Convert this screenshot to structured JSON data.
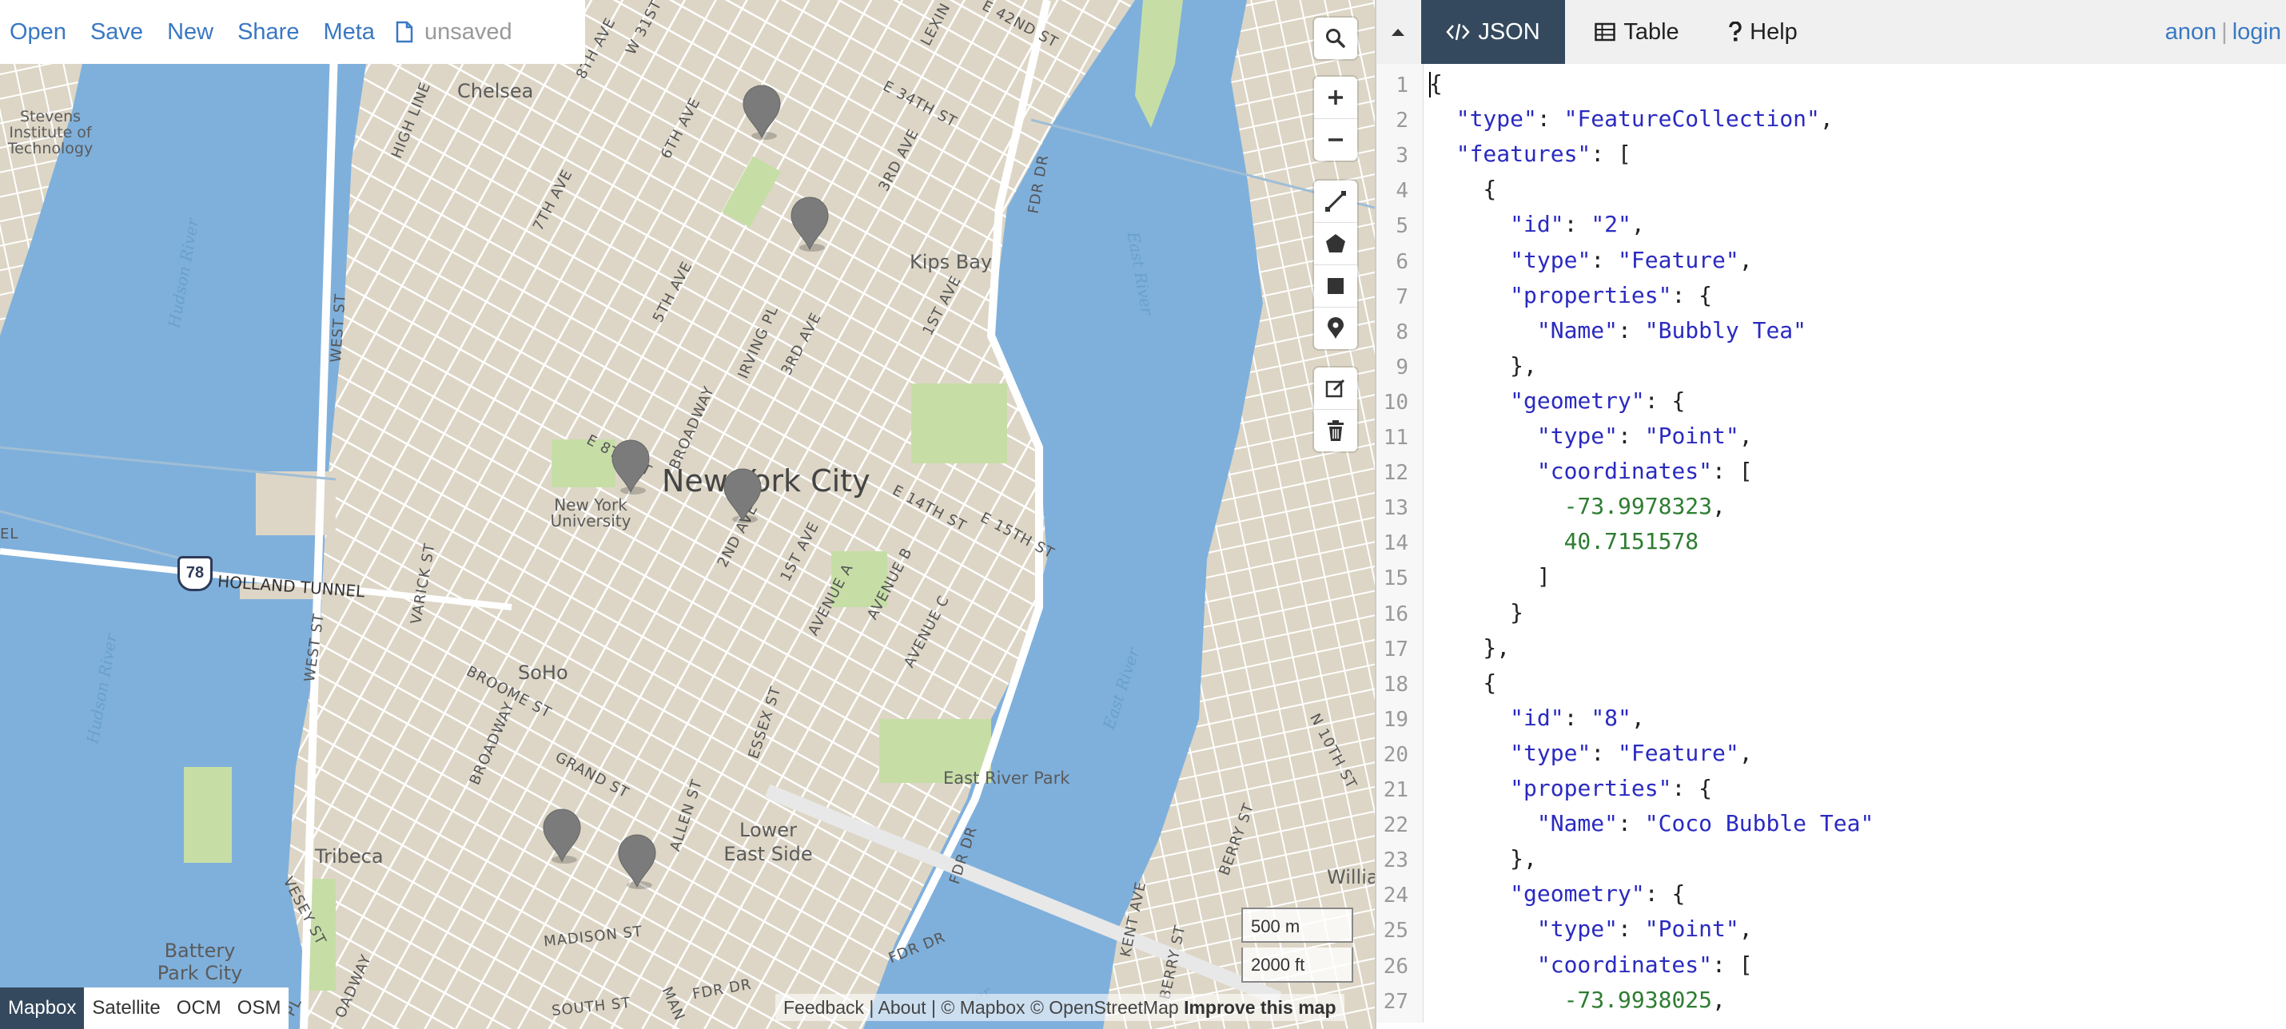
{
  "toolbar": {
    "open": "Open",
    "save": "Save",
    "new": "New",
    "share": "Share",
    "meta": "Meta",
    "file_status": "unsaved",
    "file_icon": "document-icon"
  },
  "map": {
    "city_label": "New York City",
    "labels": {
      "chelsea": "Chelsea",
      "stevens": "Stevens Institute of Technology",
      "kips_bay": "Kips Bay",
      "nyu": "New York University",
      "soho": "SoHo",
      "tribeca": "Tribeca",
      "lower_east_side": "Lower East Side",
      "east_river_park": "East River Park",
      "battery_park": "Battery Park City",
      "holland_tunnel": "HOLLAND TUNNEL",
      "hudson_river_1": "Hudson River",
      "hudson_river_2": "Hudson River",
      "east_river_1": "East River",
      "east_river_2": "East River",
      "route_78": "78",
      "willia": "Willia"
    },
    "streets": {
      "high_line": "HIGH LINE",
      "seventh_ave": "7TH AVE",
      "sixth_ave": "6TH AVE",
      "fifth_ave": "5TH AVE",
      "broadway": "BROADWAY",
      "irving_pl": "IRVING PL",
      "third_ave": "3RD AVE",
      "third_ave_2": "3RD AVE",
      "first_ave": "1ST AVE",
      "first_ave_2": "1ST AVE",
      "second_ave": "2ND AVE",
      "avenue_a": "AVENUE A",
      "avenue_b": "AVENUE B",
      "avenue_c": "AVENUE C",
      "e_34th": "E 34TH ST",
      "e_42nd": "E 42ND ST",
      "e_14th": "E 14TH ST",
      "e_15th": "E 15TH ST",
      "e_8th": "E 8TH ST",
      "w_31st": "W 31ST ST",
      "west_st": "WEST ST",
      "west_st_2": "WEST ST",
      "varick": "VARICK ST",
      "broome": "BROOME ST",
      "broadway_2": "BROADWAY",
      "grand": "GRAND ST",
      "essex": "ESSEX ST",
      "allen": "ALLEN ST",
      "madison": "MADISON ST",
      "south": "SOUTH ST",
      "fdr_1": "FDR DR",
      "fdr_2": "FDR DR",
      "fdr_3": "FDR DR",
      "fdr_4": "FDR DR",
      "vesey": "VESEY ST",
      "kent": "KENT AVE",
      "berry": "BERRY ST",
      "berry_2": "BERRY ST",
      "n_10th": "N 10TH ST",
      "lexington": "LEXIN",
      "eighth_ave": "8TH AVE",
      "el": "EL",
      "pl": "PL",
      "man": "MAN",
      "oadway": "OADWAY",
      "ver": "ver"
    },
    "controls": {
      "search": "search-icon",
      "zoom_in": "plus-icon",
      "zoom_out": "minus-icon",
      "line": "draw-line-icon",
      "polygon": "draw-polygon-icon",
      "rectangle": "draw-rectangle-icon",
      "marker": "draw-marker-icon",
      "edit": "edit-icon",
      "delete": "trash-icon"
    },
    "layers": [
      "Mapbox",
      "Satellite",
      "OCM",
      "OSM"
    ],
    "scale": {
      "metric": "500 m",
      "imperial": "2000 ft"
    },
    "attribution": {
      "feedback": "Feedback",
      "about": "About",
      "mapbox": "© Mapbox",
      "osm": "© OpenStreetMap",
      "improve": "Improve this map",
      "sep": " | "
    }
  },
  "pane": {
    "collapse_icon": "caret-up-icon",
    "tabs": [
      {
        "label": "JSON",
        "icon": "code-icon"
      },
      {
        "label": "Table",
        "icon": "table-icon"
      },
      {
        "label": "Help",
        "icon": "question-icon"
      }
    ],
    "user": {
      "anon": "anon",
      "sep": "|",
      "login": "login"
    },
    "code_lines": [
      "{",
      "  \"type\": \"FeatureCollection\",",
      "  \"features\": [",
      "    {",
      "      \"id\": \"2\",",
      "      \"type\": \"Feature\",",
      "      \"properties\": {",
      "        \"Name\": \"Bubbly Tea\"",
      "      },",
      "      \"geometry\": {",
      "        \"type\": \"Point\",",
      "        \"coordinates\": [",
      "          -73.9978323,",
      "          40.7151578",
      "        ]",
      "      }",
      "    },",
      "    {",
      "      \"id\": \"8\",",
      "      \"type\": \"Feature\",",
      "      \"properties\": {",
      "        \"Name\": \"Coco Bubble Tea\"",
      "      },",
      "      \"geometry\": {",
      "        \"type\": \"Point\",",
      "        \"coordinates\": [",
      "          -73.9938025,"
    ]
  },
  "colors": {
    "water": "#7fb0dc",
    "land": "#ddd6c6",
    "park": "#c6dea6",
    "accent": "#3a78c2",
    "active_tab": "#34495e",
    "marker": "#7b7b7b"
  }
}
